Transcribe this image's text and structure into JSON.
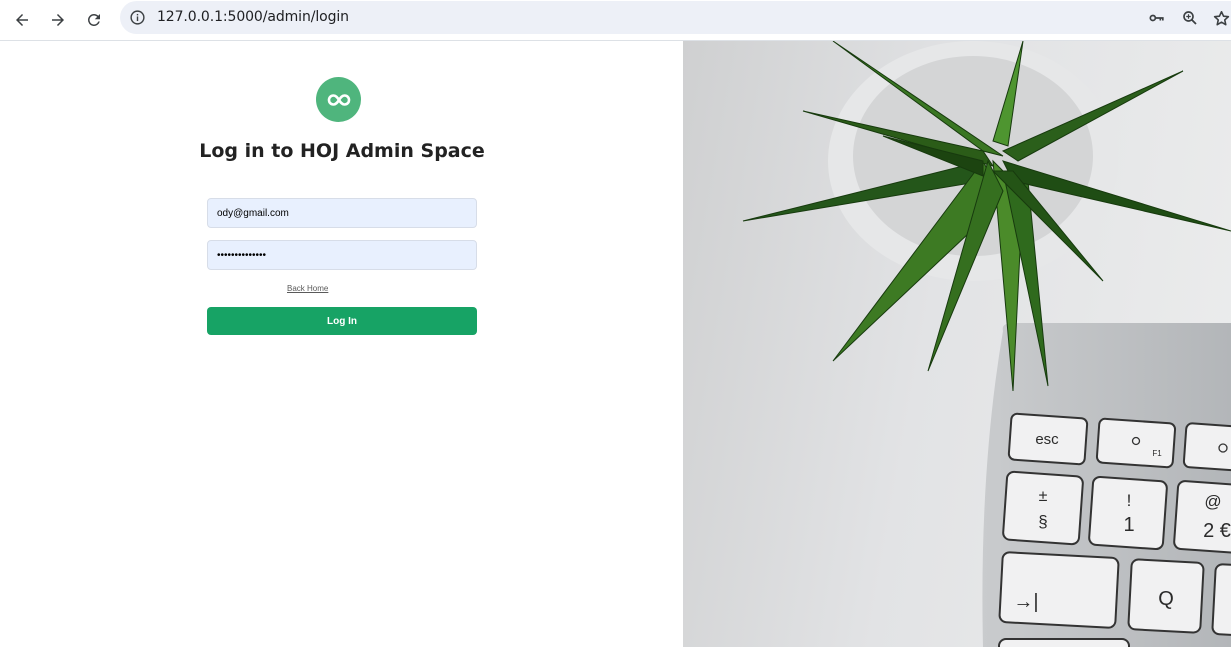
{
  "browser": {
    "url": "127.0.0.1:5000/admin/login",
    "icons": [
      "back-arrow-icon",
      "forward-arrow-icon",
      "reload-icon",
      "site-info-icon",
      "key-icon",
      "zoom-icon",
      "bookmark-star-icon"
    ]
  },
  "login": {
    "logo_icon": "infinity-icon",
    "title": "Log in to HOJ Admin Space",
    "email_value": "ody@gmail.com",
    "password_value": "••••••••••••••",
    "back_link": "Back Home",
    "submit_label": "Log In"
  },
  "photo": {
    "keyboard_keys": [
      {
        "top": "esc"
      },
      {
        "top": "F1"
      },
      {
        "top": "±",
        "bottom": "§"
      },
      {
        "top": "!",
        "bottom": "1"
      },
      {
        "top": "@",
        "bottom": "2 €"
      },
      {
        "top": "→|"
      },
      {
        "top": "Q"
      }
    ]
  },
  "colors": {
    "accent_green": "#17a365",
    "logo_green": "#4fb57d",
    "input_fill": "#e8f0fe"
  }
}
